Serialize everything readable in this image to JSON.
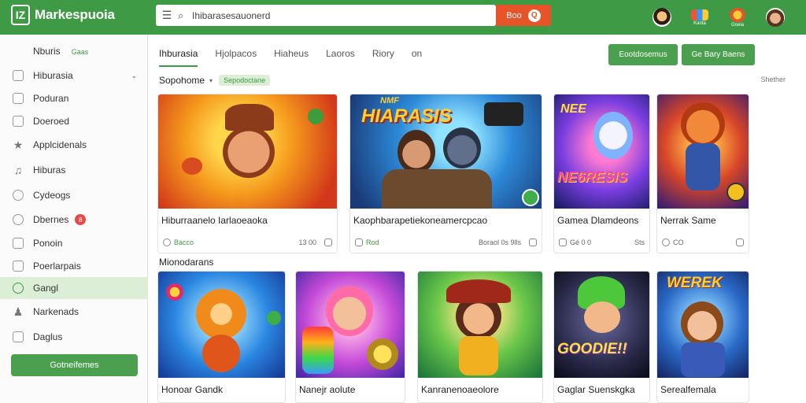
{
  "app": {
    "logo_mark": "IZ",
    "title": "Markespuoia"
  },
  "search": {
    "placeholder": "Hibaraseaonerd",
    "value": "Ihibarasesauonerd",
    "button_label": "Boo"
  },
  "header_icons": [
    {
      "name": "user-avatar",
      "label": ""
    },
    {
      "name": "games-icon",
      "label": "Kanta"
    },
    {
      "name": "rewards-icon",
      "label": "Goeia"
    },
    {
      "name": "profile-avatar",
      "label": ""
    }
  ],
  "sidebar": {
    "header": "Nburis",
    "header_sub": "Gaas",
    "items": [
      {
        "label": "Hiburasia",
        "icon": "dashboard-icon",
        "active": false,
        "chevron": true
      },
      {
        "label": "Poduran",
        "icon": "bag-icon",
        "active": false
      },
      {
        "label": "Doeroed",
        "icon": "bookmark-icon",
        "active": false
      },
      {
        "label": "Applcidenals",
        "icon": "star-icon",
        "active": false
      },
      {
        "label": "Hiburas",
        "icon": "bell-icon",
        "active": false
      },
      {
        "label": "Cydeogs",
        "icon": "user-icon",
        "active": false
      },
      {
        "label": "Dbernes",
        "icon": "gamepad-icon",
        "active": false,
        "badge": "8"
      },
      {
        "label": "Ponoin",
        "icon": "file-icon",
        "active": false
      },
      {
        "label": "Poerlarpais",
        "icon": "document-icon",
        "active": false
      },
      {
        "label": "Gangl",
        "icon": "clock-icon",
        "active": true
      },
      {
        "label": "Narkenads",
        "icon": "people-icon",
        "active": false
      },
      {
        "label": "Daglus",
        "icon": "page-icon",
        "active": false
      }
    ],
    "button_label": "Gotneifemes"
  },
  "tabs": [
    "Ihburasia",
    "Hjolpacos",
    "Hiaheus",
    "Laoros",
    "Riory",
    "on"
  ],
  "buttons": {
    "primary": "Eootdosemus",
    "secondary": "Ge Bary Baens"
  },
  "sort": {
    "label": "Sopohome",
    "chip": "Sepodoctane",
    "see_all": "Shether"
  },
  "row1": [
    {
      "title": "Hiburraanelo Iarlaoeaoka",
      "meta_left": "Bacco",
      "meta_right": "13 00"
    },
    {
      "title": "Kaophbarapetiekoneamercpcao",
      "meta_left": "Rod",
      "meta_right": "Boraol 0s 9lls"
    },
    {
      "title": "Gamea Dlamdeons",
      "meta_left": "Gé 0 0",
      "meta_right": "Sts"
    },
    {
      "title": "Nerrak Same",
      "meta_left": "CO",
      "meta_right": ""
    }
  ],
  "section2_title": "Mionodarans",
  "row2": [
    {
      "title": "Honoar Gandk"
    },
    {
      "title": "Nanejr aolute"
    },
    {
      "title": "Kanranenoaeolore"
    },
    {
      "title": "Gaglar Suenskgka"
    },
    {
      "title": "Serealfemala"
    }
  ],
  "art_text": {
    "hero2": "HIARASIS",
    "hero2_top": "NMF",
    "hero3": "NE6RESIS",
    "hero3_top": "NEE",
    "row2_4": "GOODIE!!",
    "row2_5": "WEREK"
  }
}
